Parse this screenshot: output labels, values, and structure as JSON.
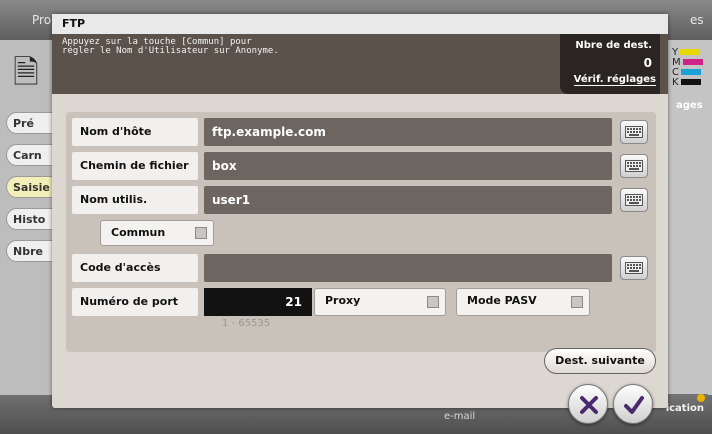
{
  "background": {
    "top_tabs": [
      "Pro",
      "es"
    ],
    "left_items": [
      "Pré",
      "Carn",
      "Saisie",
      "Histo",
      "Nbre"
    ],
    "right_tab": "ages",
    "bottom_labels": [
      "",
      "",
      "",
      "",
      "e-mail"
    ],
    "trailing_button": "ication",
    "cmyk": [
      "Y",
      "M",
      "C",
      "K"
    ]
  },
  "dialog": {
    "title": "FTP",
    "message": "Appuyez sur la touche [Commun] pour\nrégler le Nom d'Utilisateur sur Anonyme.",
    "dest_count_label": "Nbre de dest.",
    "dest_count": "0",
    "verify_settings": "Vérif. réglages"
  },
  "form": {
    "hostname": {
      "label": "Nom d'hôte",
      "value": "ftp.example.com"
    },
    "filepath": {
      "label": "Chemin de fichier",
      "value": "box"
    },
    "username": {
      "label": "Nom utilis.",
      "value": "user1"
    },
    "common": {
      "label": "Commun",
      "checked": false
    },
    "password": {
      "label": "Code d'accès",
      "value": ""
    },
    "port": {
      "label": "Numéro de port",
      "value": "21",
      "range": "1 - 65535"
    },
    "proxy": {
      "label": "Proxy",
      "checked": false
    },
    "pasv": {
      "label": "Mode PASV",
      "checked": false
    }
  },
  "buttons": {
    "next_dest": "Dest. suivante",
    "cancel_icon": "close-icon",
    "ok_icon": "check-icon"
  },
  "colors": {
    "field_bg": "#6c6560",
    "dialog_bg": "#dcd7d0",
    "cancel_accent": "#4a2a6e"
  }
}
